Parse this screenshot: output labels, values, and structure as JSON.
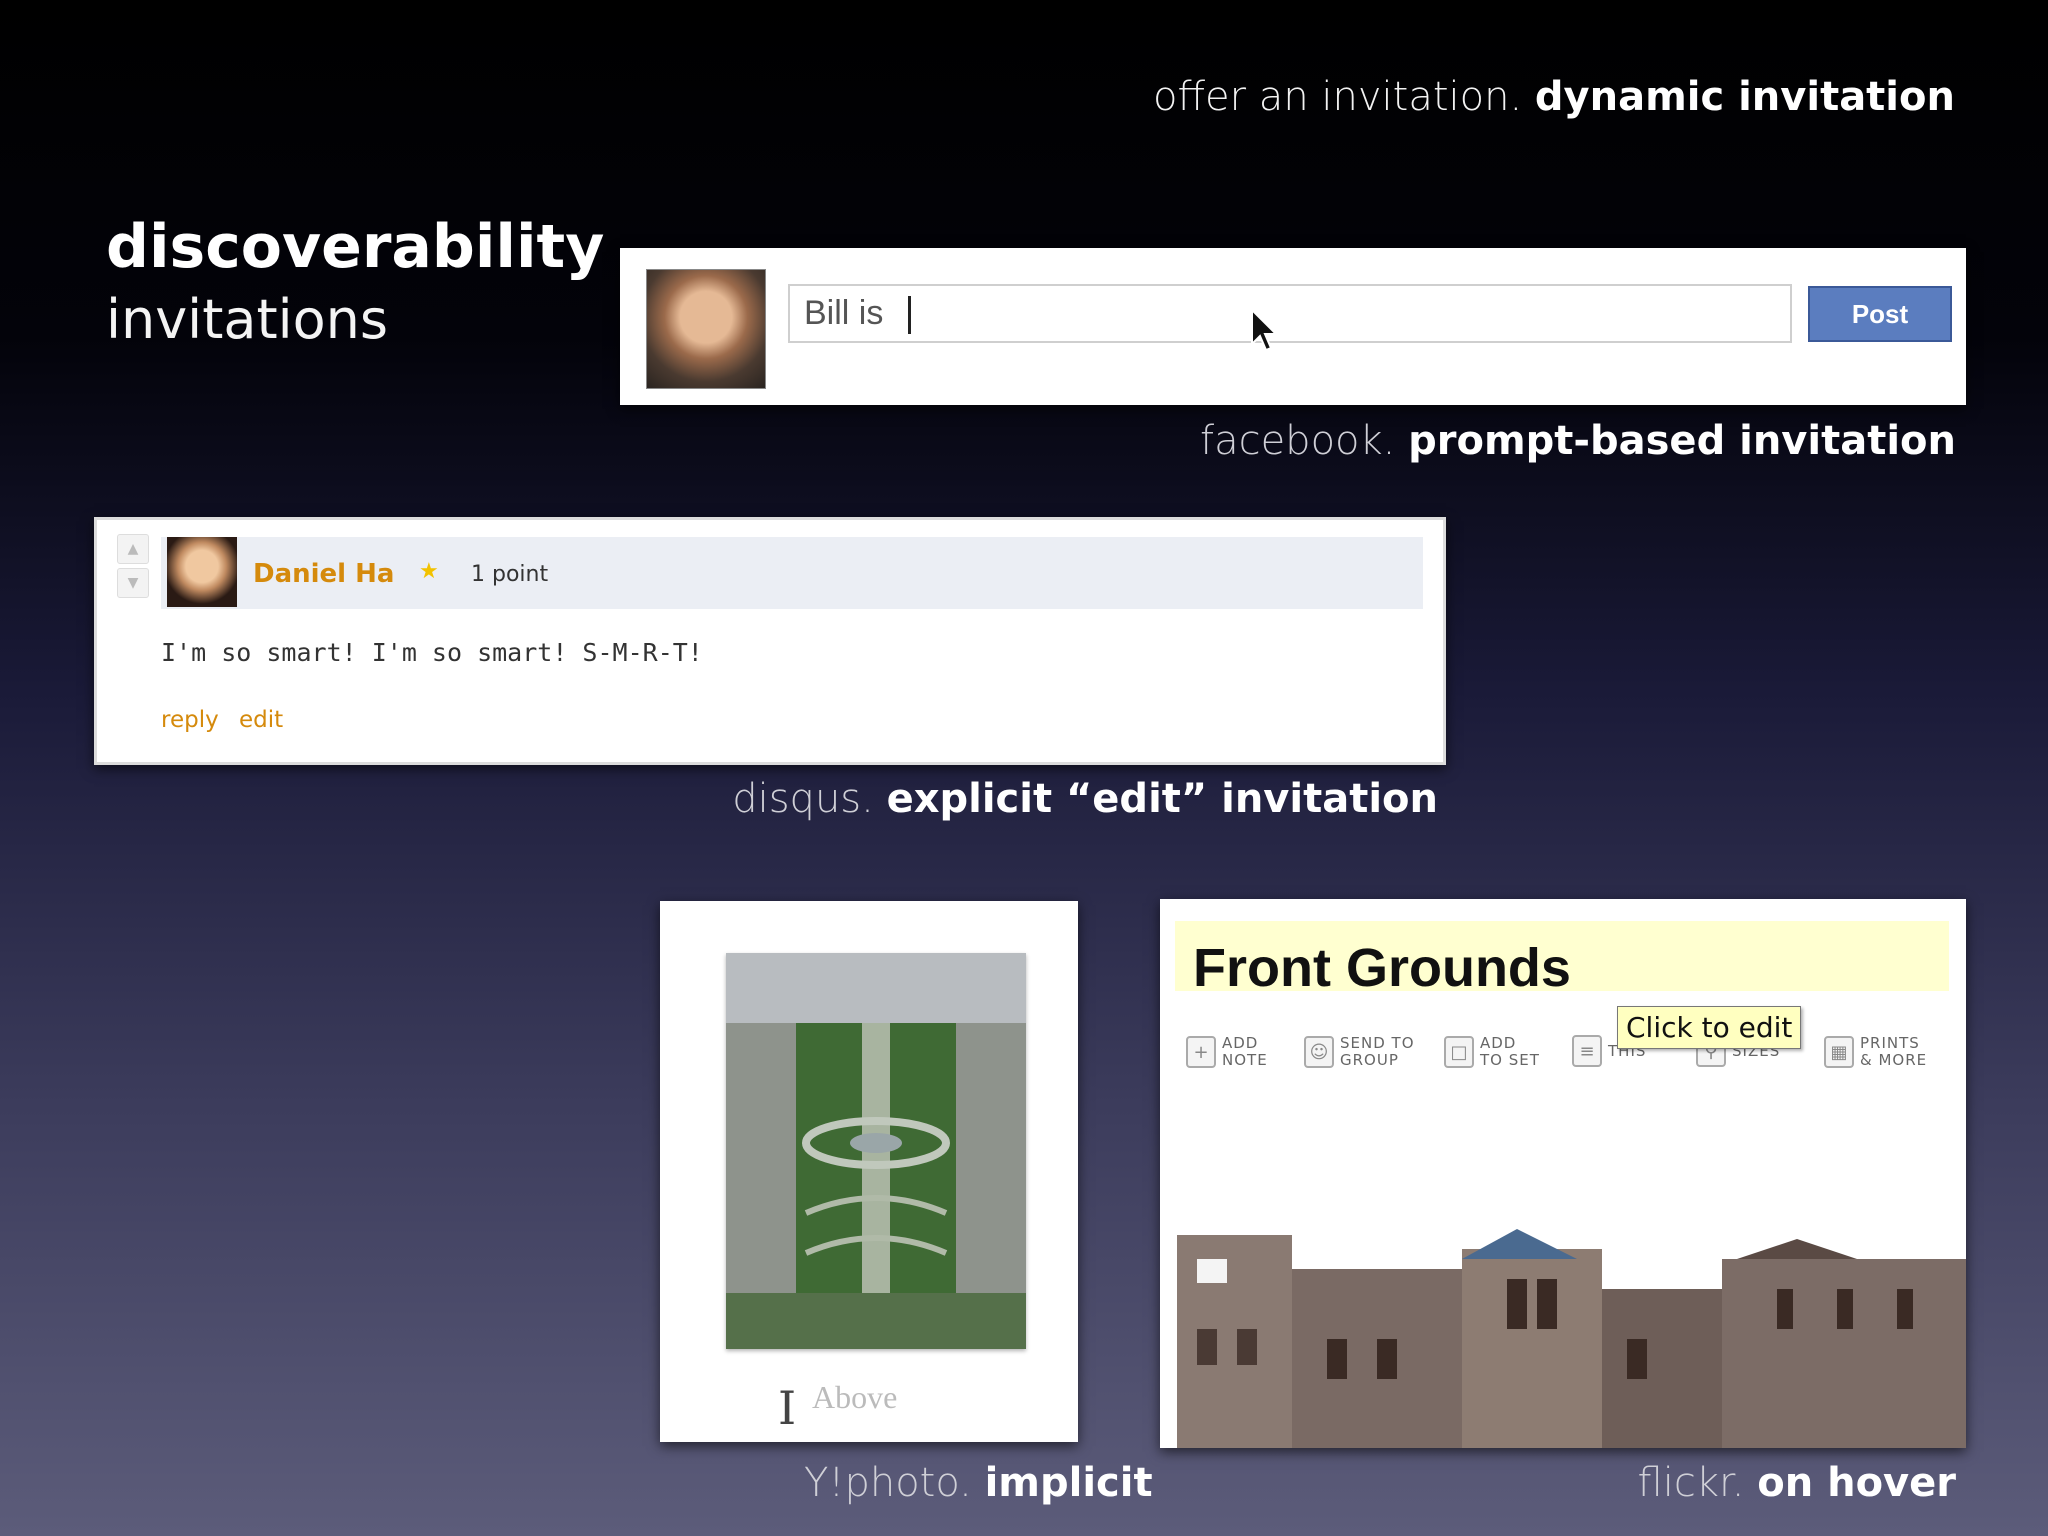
{
  "header": {
    "light": "offer an invitation.",
    "bold": "dynamic invitation"
  },
  "title": "discoverability",
  "subtitle": "invitations",
  "facebook": {
    "input_value": "Bill is",
    "post_label": "Post",
    "caption_light": "facebook.",
    "caption_bold": "prompt-based invitation"
  },
  "disqus": {
    "user_name": "Daniel Ha",
    "points": "1 point",
    "comment": "I'm so smart! I'm so smart! S-M-R-T!",
    "reply_label": "reply",
    "edit_label": "edit",
    "caption_light": "disqus.",
    "caption_bold": "explicit “edit” invitation"
  },
  "yphoto": {
    "label": "Above",
    "caption_light": "Y!photo.",
    "caption_bold": "implicit"
  },
  "flickr": {
    "title": "Front Grounds",
    "tooltip": "Click to edit",
    "tools": [
      {
        "line1": "ADD",
        "line2": "NOTE"
      },
      {
        "line1": "SEND TO",
        "line2": "GROUP"
      },
      {
        "line1": "ADD",
        "line2": "TO SET"
      },
      {
        "line1": "",
        "line2": "THIS"
      },
      {
        "line1": "",
        "line2": "SIZES"
      },
      {
        "line1": "PRINTS",
        "line2": "& MORE"
      }
    ],
    "caption_light": "flickr.",
    "caption_bold": "on hover"
  },
  "colors": {
    "disqus_accent": "#d58a0c",
    "facebook_button": "#5b7dbf",
    "tooltip_bg": "#ffffc0"
  }
}
